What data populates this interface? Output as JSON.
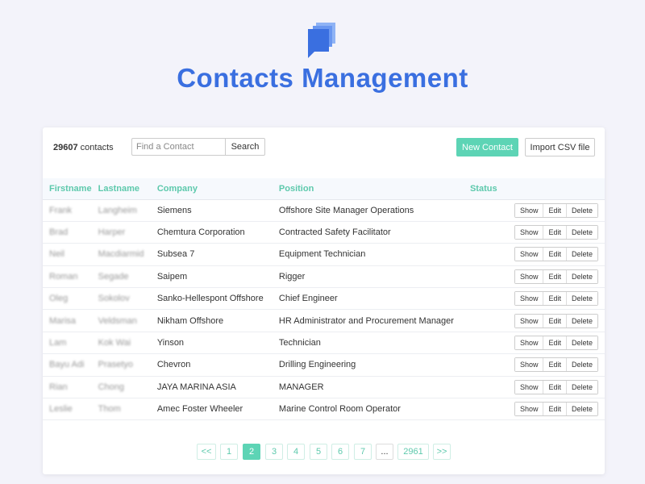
{
  "app": {
    "title": "Contacts Management",
    "logo_icon": "chat-bubbles-icon"
  },
  "colors": {
    "accent": "#5dd4b5",
    "title": "#3a6fe0",
    "background": "#f3f3fa"
  },
  "toolbar": {
    "count": "29607",
    "count_label": "contacts",
    "search_placeholder": "Find a Contact",
    "search_label": "Search",
    "new_contact_label": "New Contact",
    "import_label": "Import CSV file"
  },
  "table": {
    "headers": [
      "Firstname",
      "Lastname",
      "Company",
      "Position",
      "Status"
    ],
    "actions": [
      "Show",
      "Edit",
      "Delete"
    ],
    "rows": [
      {
        "firstname": "Frank",
        "lastname": "Langheim",
        "company": "Siemens",
        "position": "Offshore Site Manager Operations",
        "status": ""
      },
      {
        "firstname": "Brad",
        "lastname": "Harper",
        "company": "Chemtura Corporation",
        "position": "Contracted Safety Facilitator",
        "status": ""
      },
      {
        "firstname": "Neil",
        "lastname": "Macdiarmid",
        "company": "Subsea 7",
        "position": "Equipment Technician",
        "status": ""
      },
      {
        "firstname": "Roman",
        "lastname": "Segade",
        "company": "Saipem",
        "position": "Rigger",
        "status": ""
      },
      {
        "firstname": "Oleg",
        "lastname": "Sokolov",
        "company": "Sanko-Hellespont Offshore",
        "position": "Chief Engineer",
        "status": ""
      },
      {
        "firstname": "Marisa",
        "lastname": "Veldsman",
        "company": "Nikham Offshore",
        "position": "HR Administrator and Procurement Manager",
        "status": ""
      },
      {
        "firstname": "Lam",
        "lastname": "Kok Wai",
        "company": "Yinson",
        "position": "Technician",
        "status": ""
      },
      {
        "firstname": "Bayu Adi",
        "lastname": "Prasetyo",
        "company": "Chevron",
        "position": "Drilling Engineering",
        "status": ""
      },
      {
        "firstname": "Rian",
        "lastname": "Chong",
        "company": "JAYA MARINA ASIA",
        "position": "MANAGER",
        "status": ""
      },
      {
        "firstname": "Leslie",
        "lastname": "Thom",
        "company": "Amec Foster Wheeler",
        "position": "Marine Control Room Operator",
        "status": ""
      }
    ]
  },
  "pagination": {
    "first": "<<",
    "pages": [
      "1",
      "2",
      "3",
      "4",
      "5",
      "6",
      "7"
    ],
    "active_page": "2",
    "ellipsis": "...",
    "last_page": "2961",
    "next": ">>"
  }
}
